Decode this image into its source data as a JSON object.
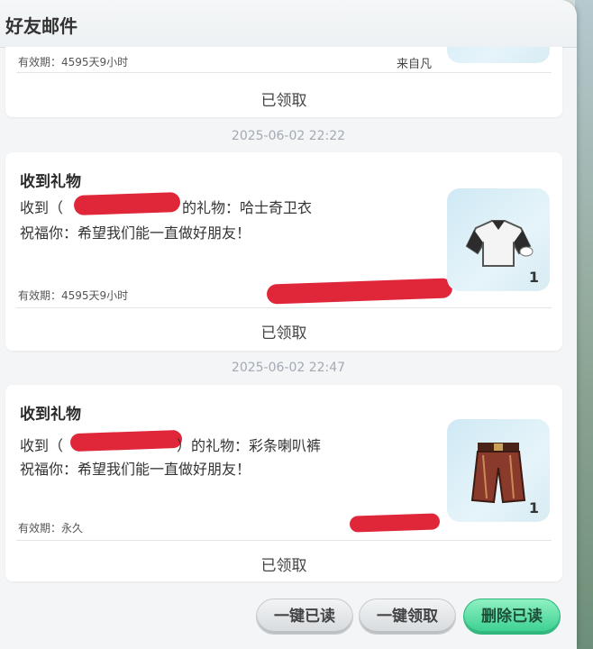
{
  "window": {
    "title": "好友邮件"
  },
  "mails": [
    {
      "expiry": "有效期：4595天9小时",
      "from": "来自凡",
      "status": "已领取"
    },
    {
      "date": "2025-06-02 22:22",
      "title": "收到礼物",
      "line1_prefix": "收到（",
      "line1_suffix": "的礼物：哈士奇卫衣",
      "line2": "祝福你：希望我们能一直做好朋友！",
      "expiry": "有效期：4595天9小时",
      "gift_icon": "husky-hoodie-icon",
      "gift_count": "1",
      "status": "已领取"
    },
    {
      "date": "2025-06-02 22:47",
      "title": "收到礼物",
      "line1_prefix": "收到（",
      "line1_suffix": "）的礼物：彩条喇叭裤",
      "line2": "祝福你：希望我们能一直做好朋友！",
      "expiry": "有效期：永久",
      "gift_icon": "flared-pants-icon",
      "gift_count": "1",
      "status": "已领取"
    }
  ],
  "footer": {
    "read_all": "一键已读",
    "claim_all": "一键领取",
    "delete_read": "删除已读"
  },
  "colors": {
    "accent_green": "#37cf8f",
    "redaction": "#e0273a"
  }
}
